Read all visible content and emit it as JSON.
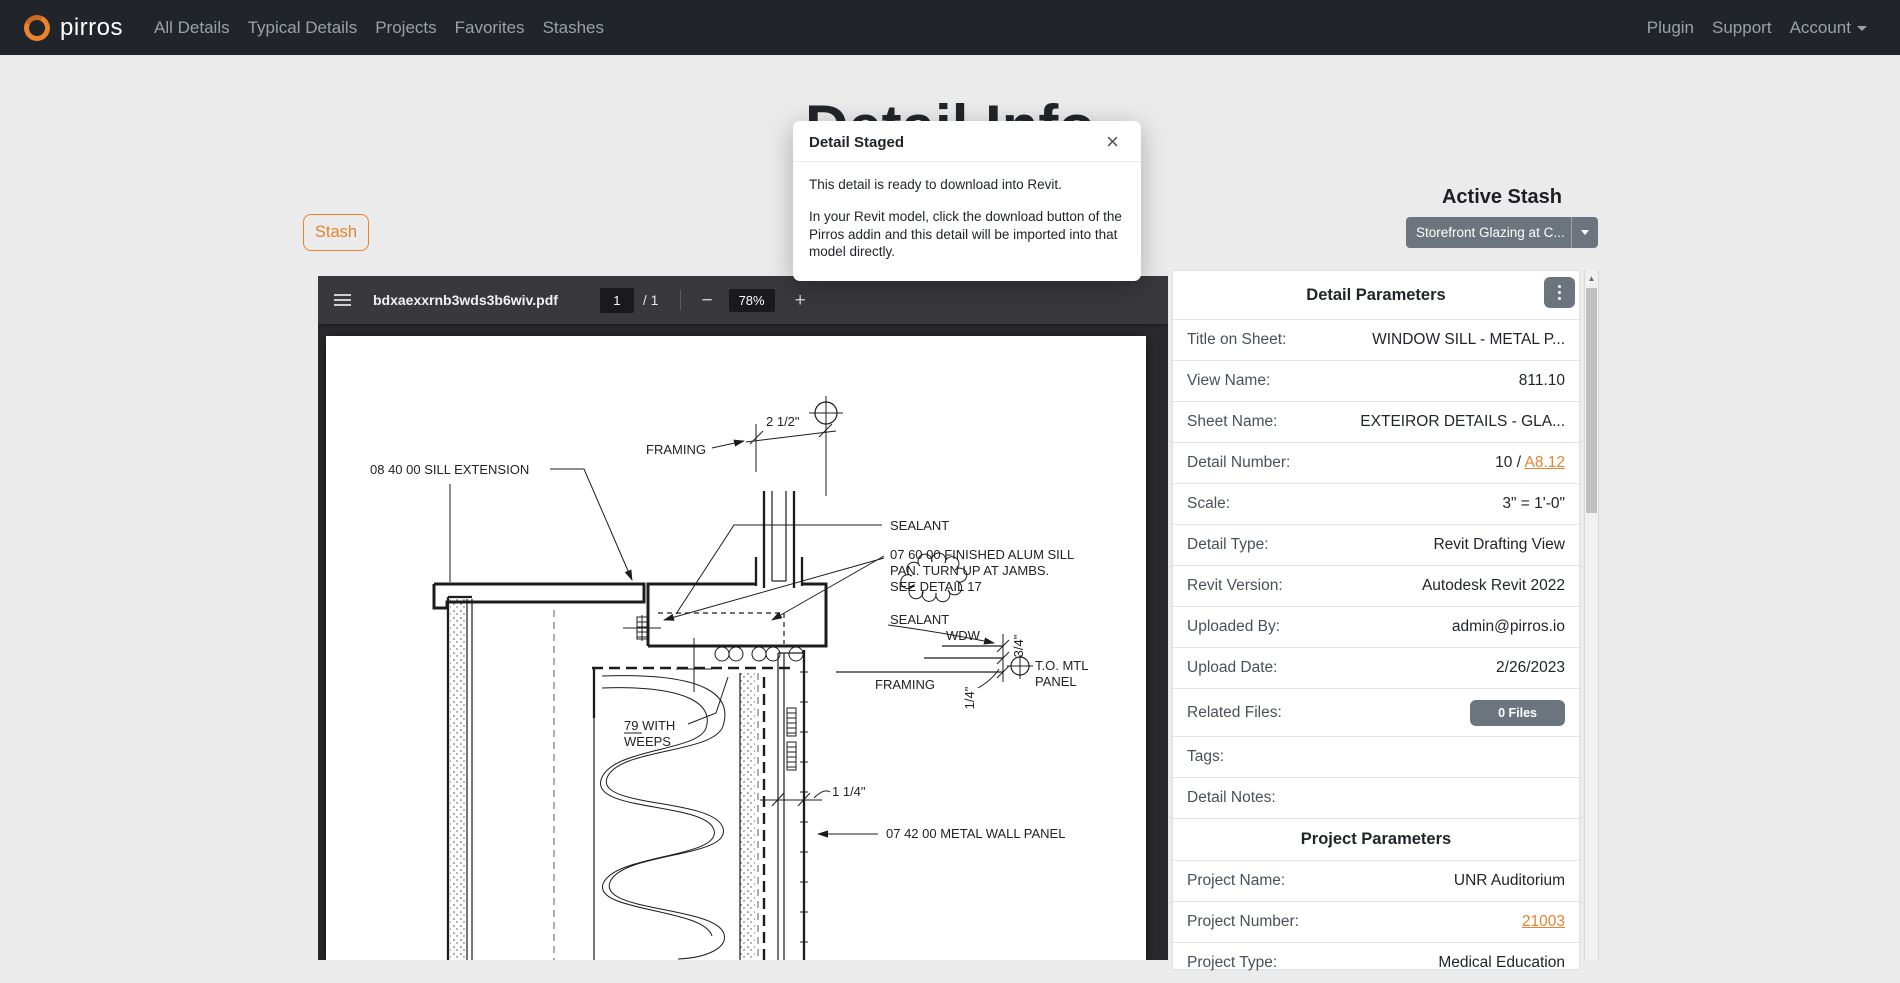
{
  "navbar": {
    "brand": "pirros",
    "items": [
      {
        "label": "All Details"
      },
      {
        "label": "Typical Details"
      },
      {
        "label": "Projects"
      },
      {
        "label": "Favorites"
      },
      {
        "label": "Stashes"
      }
    ],
    "right_items": [
      {
        "label": "Plugin"
      },
      {
        "label": "Support"
      },
      {
        "label": "Account"
      }
    ]
  },
  "page": {
    "title": "Detail Info"
  },
  "stash_button_label": "Stash",
  "modal": {
    "title": "Detail Staged",
    "close_icon": "×",
    "paragraph1": "This detail is ready to download into Revit.",
    "paragraph2": "In your Revit model, click the download button of the Pirros addin and this detail will be imported into that model directly."
  },
  "pdf_viewer": {
    "filename": "bdxaexxrnb3wds3b6wiv.pdf",
    "page_number": "1",
    "page_count": "/ 1",
    "zoom_out_label": "−",
    "zoom_level": "78%",
    "zoom_in_label": "+"
  },
  "active_stash": {
    "heading": "Active Stash",
    "selected_option": "Storefront Glazing at C..."
  },
  "detail_panel": {
    "title": "Detail Parameters",
    "rows": [
      {
        "label": "Title on Sheet:",
        "value": "WINDOW SILL - METAL P..."
      },
      {
        "label": "View Name:",
        "value": "811.10"
      },
      {
        "label": "Sheet Name:",
        "value": "EXTEIROR DETAILS - GLA..."
      },
      {
        "label": "Detail Number:",
        "value_prefix": "10 / ",
        "link": "A8.12"
      },
      {
        "label": "Scale:",
        "value": "3\" = 1'-0\""
      },
      {
        "label": "Detail Type:",
        "value": "Revit Drafting View"
      },
      {
        "label": "Revit Version:",
        "value": "Autodesk Revit 2022"
      },
      {
        "label": "Uploaded By:",
        "value": "admin@pirros.io"
      },
      {
        "label": "Upload Date:",
        "value": "2/26/2023"
      },
      {
        "label": "Related Files:",
        "button": "0 Files"
      },
      {
        "label": "Tags:",
        "value": ""
      },
      {
        "label": "Detail Notes:",
        "value": ""
      }
    ],
    "project_section_title": "Project Parameters",
    "project_rows": [
      {
        "label": "Project Name:",
        "value": "UNR Auditorium"
      },
      {
        "label": "Project Number:",
        "link": "21003"
      },
      {
        "label": "Project Type:",
        "value": "Medical Education"
      }
    ]
  },
  "drawing": {
    "dim_top": "2 1/2\"",
    "framing_top": "FRAMING",
    "sill_extension": "08 40 00  SILL EXTENSION",
    "sealant_upper": "SEALANT",
    "alum_sill_1": "07 60 00  FINISHED ALUM SILL",
    "alum_sill_2": "PAN. TURN UP AT JAMBS.",
    "alum_sill_3": "SEE DETAIL 17",
    "sealant_lower": "SEALANT",
    "wdw": "WDW",
    "dim_34": "3/4\"",
    "to_mtl_1": "T.O. MTL",
    "to_mtl_2": "PANEL",
    "framing_bottom": "FRAMING",
    "dim_14": "1/4\"",
    "weeps_1": "79  WITH",
    "weeps_2": "WEEPS",
    "dim_114": "1 1/4\"",
    "metal_wall_panel": "07 42 00  METAL WALL PANEL"
  },
  "colors": {
    "accent_orange": "#e8832e",
    "navbar_bg": "#212529",
    "secondary_gray": "#6c757d",
    "pdf_toolbar_bg": "#38383d"
  }
}
